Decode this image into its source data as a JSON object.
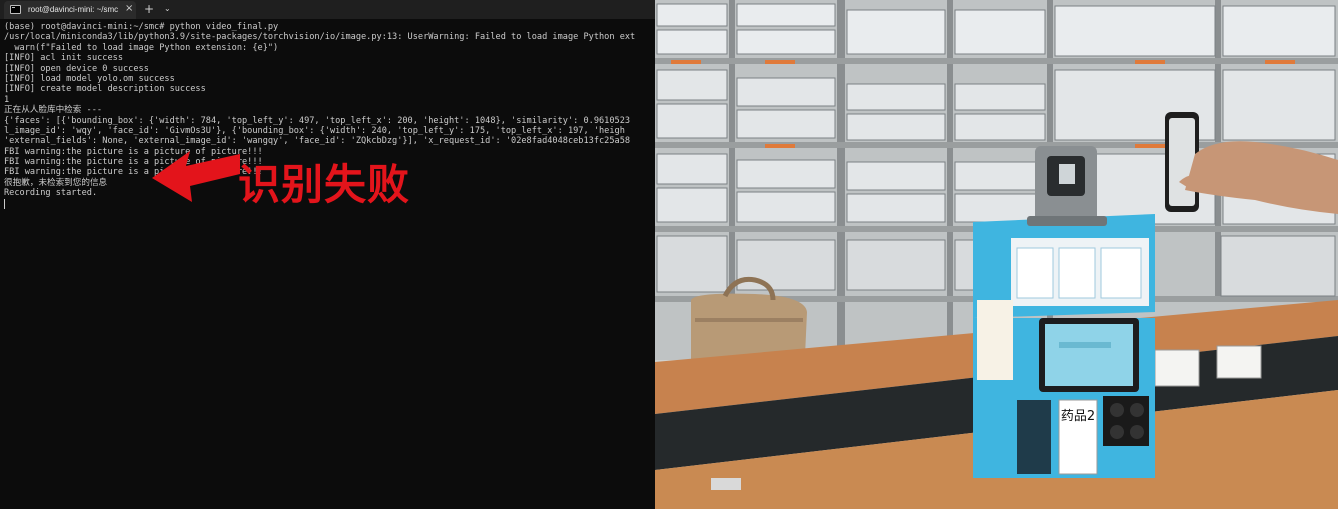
{
  "terminal": {
    "tab_title": "root@davinci-mini: ~/smc",
    "tab_close": "×",
    "new_tab": "+",
    "tab_dropdown": "⌄",
    "lines": [
      "(base) root@davinci-mini:~/smc# python video_final.py",
      "/usr/local/miniconda3/lib/python3.9/site-packages/torchvision/io/image.py:13: UserWarning: Failed to load image Python ext",
      "  warn(f\"Failed to load image Python extension: {e}\")",
      "[INFO] acl init success",
      "[INFO] open device 0 success",
      "[INFO] load model yolo.om success",
      "[INFO] create model description success",
      "1",
      "正在从人脸库中检索 ---",
      "{'faces': [{'bounding_box': {'width': 784, 'top_left_y': 497, 'top_left_x': 200, 'height': 1048}, 'similarity': 0.9610523",
      "l_image_id': 'wqy', 'face_id': 'GivmOs3U'}, {'bounding_box': {'width': 240, 'top_left_y': 175, 'top_left_x': 197, 'heigh",
      "'external_fields': None, 'external_image_id': 'wangqy', 'face_id': 'ZQkcbDzg'}], 'x_request_id': '02e8fad4048ceb13fc25a58",
      "FBI warning:the picture is a picture of picture!!!",
      "FBI warning:the picture is a picture of picture!!!",
      "FBI warning:the picture is a picture of picture!!!",
      "很抱歉，未检索到您的信息",
      "Recording started."
    ]
  },
  "annotation": {
    "label": "识别失败",
    "color": "#e3141b"
  },
  "photo": {
    "box_label": "药品2"
  }
}
